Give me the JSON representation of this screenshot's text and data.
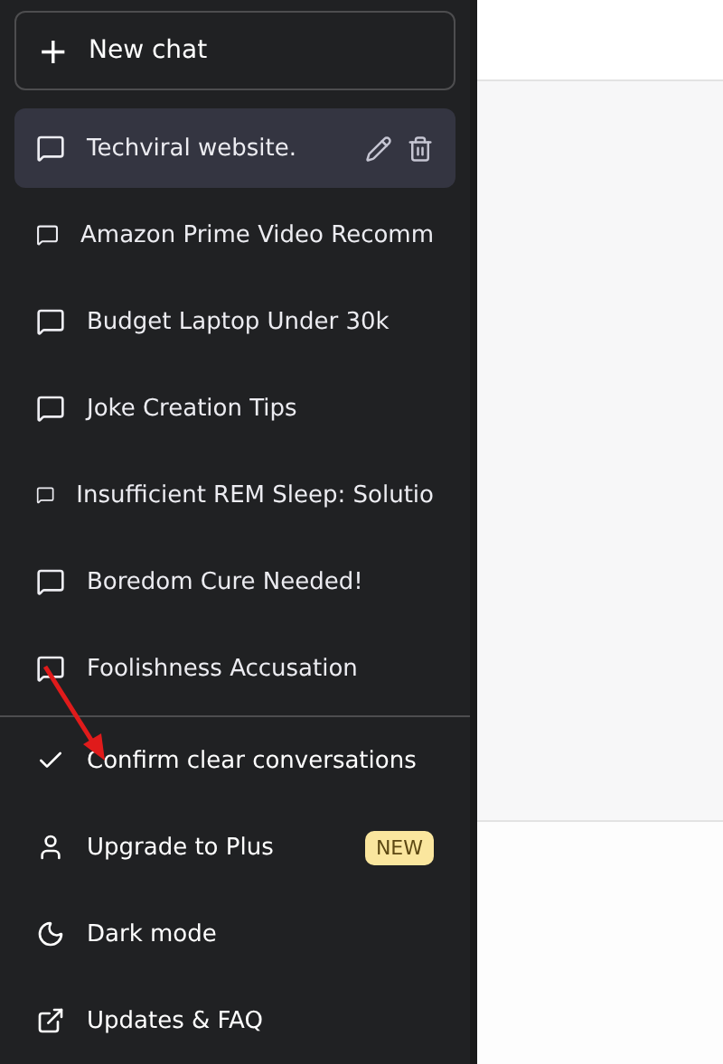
{
  "new_chat": {
    "label": "New chat",
    "icon": "+"
  },
  "chats": [
    {
      "title": "Techviral website.",
      "selected": true
    },
    {
      "title": "Amazon Prime Video Recomm",
      "selected": false
    },
    {
      "title": "Budget Laptop Under 30k",
      "selected": false
    },
    {
      "title": "Joke Creation Tips",
      "selected": false
    },
    {
      "title": "Insufficient REM Sleep: Solutio",
      "selected": false
    },
    {
      "title": "Boredom Cure Needed!",
      "selected": false
    },
    {
      "title": "Foolishness Accusation",
      "selected": false
    }
  ],
  "menu": [
    {
      "kind": "check",
      "label": "Confirm clear conversations"
    },
    {
      "kind": "user",
      "label": "Upgrade to Plus",
      "badge": "NEW"
    },
    {
      "kind": "moon",
      "label": "Dark mode"
    },
    {
      "kind": "external",
      "label": "Updates & FAQ"
    }
  ]
}
